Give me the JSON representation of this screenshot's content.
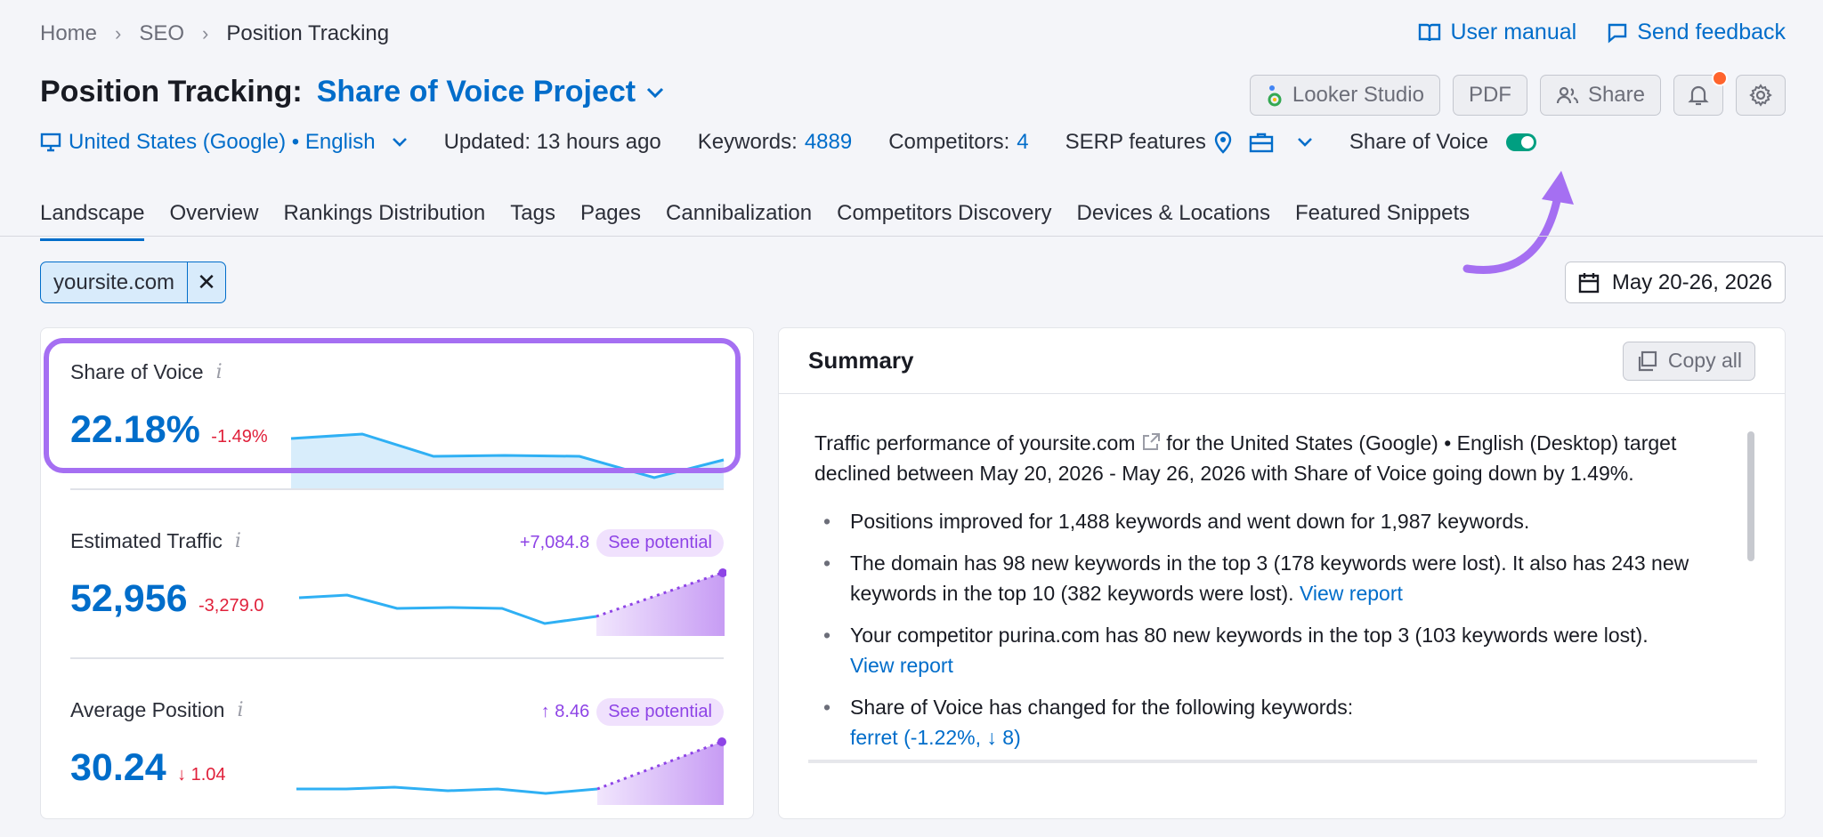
{
  "breadcrumb": {
    "home": "Home",
    "seo": "SEO",
    "current": "Position Tracking"
  },
  "top_links": {
    "manual": "User manual",
    "feedback": "Send feedback"
  },
  "title": {
    "prefix": "Position Tracking:",
    "project": "Share of Voice Project"
  },
  "actions": {
    "looker": "Looker Studio",
    "pdf": "PDF",
    "share": "Share"
  },
  "meta": {
    "location": "United States (Google) • English",
    "updated": "Updated: 13 hours ago",
    "keywords_label": "Keywords:",
    "keywords_value": "4889",
    "competitors_label": "Competitors:",
    "competitors_value": "4",
    "serp_label": "SERP features",
    "sov_label": "Share of Voice"
  },
  "tabs": [
    "Landscape",
    "Overview",
    "Rankings Distribution",
    "Tags",
    "Pages",
    "Cannibalization",
    "Competitors Discovery",
    "Devices & Locations",
    "Featured Snippets"
  ],
  "filter": {
    "domain": "yoursite.com"
  },
  "date_range": "May 20-26, 2026",
  "metrics": {
    "sov": {
      "label": "Share of Voice",
      "value": "22.18%",
      "delta": "-1.49%"
    },
    "traffic": {
      "label": "Estimated Traffic",
      "value": "52,956",
      "delta": "-3,279.0",
      "potential": "+7,084.8",
      "pill": "See potential"
    },
    "position": {
      "label": "Average Position",
      "value": "30.24",
      "delta": "↓ 1.04",
      "potential": "↑ 8.46",
      "pill": "See potential"
    }
  },
  "summary": {
    "title": "Summary",
    "copy": "Copy all",
    "intro_1": "Traffic performance of",
    "intro_domain": "yoursite.com",
    "intro_2": "for the United States (Google) • English (Desktop) target declined between May 20, 2026 - May 26, 2026 with Share of Voice going down by 1.49%.",
    "b1": "Positions improved for 1,488 keywords and went down for 1,987 keywords.",
    "b2": "The domain has 98 new keywords in the top 3 (178 keywords were lost). It also has 243 new keywords in the top 10 (382 keywords were lost).",
    "b2_link": "View report",
    "b3": "Your competitor purina.com has 80 new keywords in the top 3 (103 keywords were lost).",
    "b3_link": "View report",
    "b4": "Share of Voice has changed for the following keywords:",
    "b4_partial": "ferret (-1.22%, ↓ 8)"
  },
  "colors": {
    "accent": "#006dca",
    "negative": "#e0203a",
    "potential": "#8e44e6",
    "highlight": "#a56ff2",
    "toggle_on": "#009f81"
  }
}
